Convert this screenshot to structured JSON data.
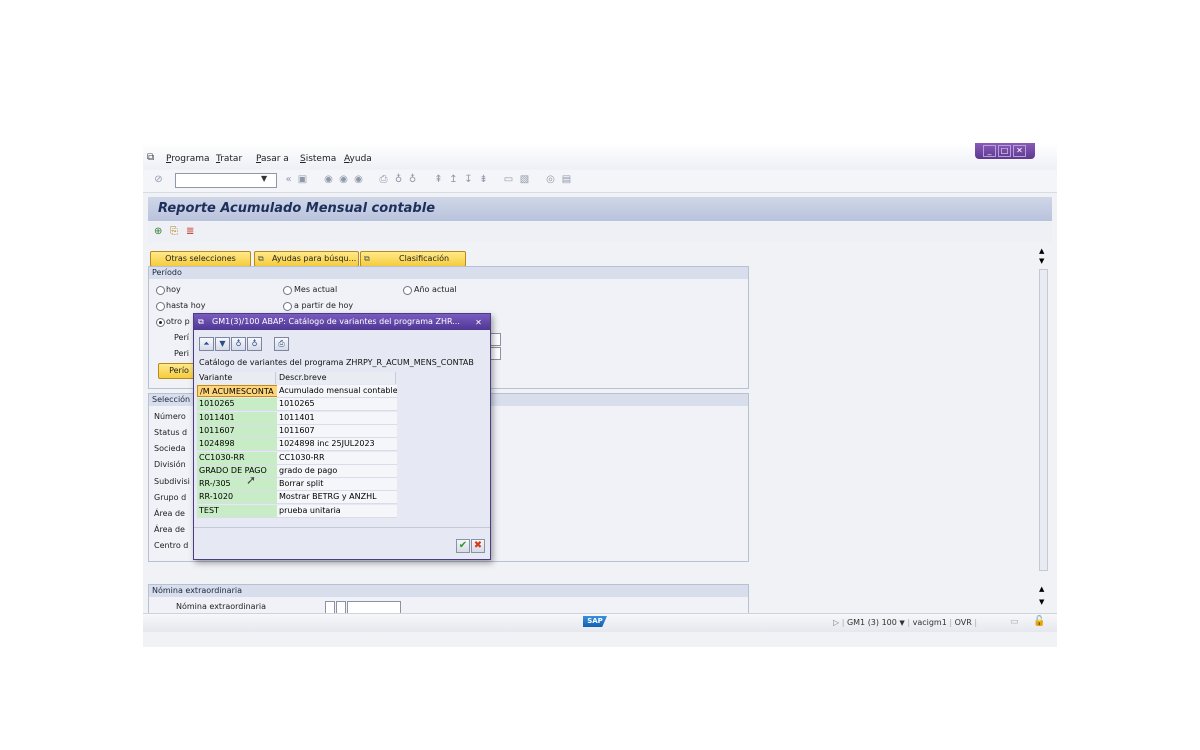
{
  "menu": {
    "items": [
      "Programa",
      "Tratar",
      "Pasar a",
      "Sistema",
      "Ayuda"
    ]
  },
  "window_controls": {
    "minimize": "_",
    "maximize": "□",
    "close": "✕"
  },
  "toolbar": {
    "command_field_value": ""
  },
  "title": "Reporte Acumulado Mensual contable",
  "buttons": {
    "other_selections": "Otras selecciones",
    "search_help": "Ayudas para búsqu...",
    "sort": "Clasificación"
  },
  "periodo": {
    "heading": "Período",
    "options": [
      "hoy",
      "Mes actual",
      "Año actual",
      "hasta hoy",
      "a partir de hoy",
      "otro p"
    ],
    "selected": "otro p",
    "period_labels": [
      "Perí",
      "Peri"
    ],
    "period_button": "Perío"
  },
  "seleccion": {
    "heading": "Selección",
    "fields": [
      "Número",
      "Status d",
      "Socieda",
      "División",
      "Subdivisi",
      "Grupo d",
      "Área de",
      "Área de",
      "Centro d"
    ]
  },
  "nomina": {
    "heading": "Nómina extraordinaria",
    "field_label": "Nómina extraordinaria"
  },
  "status_bar": {
    "logo": "SAP",
    "system": "GM1 (3) 100",
    "user": "vacigm1",
    "mode": "OVR"
  },
  "popup": {
    "title": "GM1(3)/100 ABAP: Catálogo de variantes del programa ZHR...",
    "heading": "Catálogo de variantes del programa ZHRPY_R_ACUM_MENS_CONTAB",
    "columns": [
      "Variante",
      "Descr.breve"
    ],
    "rows": [
      {
        "variant": "/M ACUMESCONTA",
        "desc": "Acumulado mensual contable"
      },
      {
        "variant": "1010265",
        "desc": "1010265"
      },
      {
        "variant": "1011401",
        "desc": "1011401"
      },
      {
        "variant": "1011607",
        "desc": "1011607"
      },
      {
        "variant": "1024898",
        "desc": "1024898 inc 25JUL2023"
      },
      {
        "variant": "CC1030-RR",
        "desc": "CC1030-RR"
      },
      {
        "variant": "GRADO DE PAGO",
        "desc": "grado de pago"
      },
      {
        "variant": "RR-/305",
        "desc": "Borrar split"
      },
      {
        "variant": "RR-1020",
        "desc": "Mostrar BETRG y ANZHL"
      },
      {
        "variant": "TEST",
        "desc": "prueba unitaria"
      }
    ],
    "ok_symbol": "✔",
    "cancel_symbol": "✖"
  }
}
